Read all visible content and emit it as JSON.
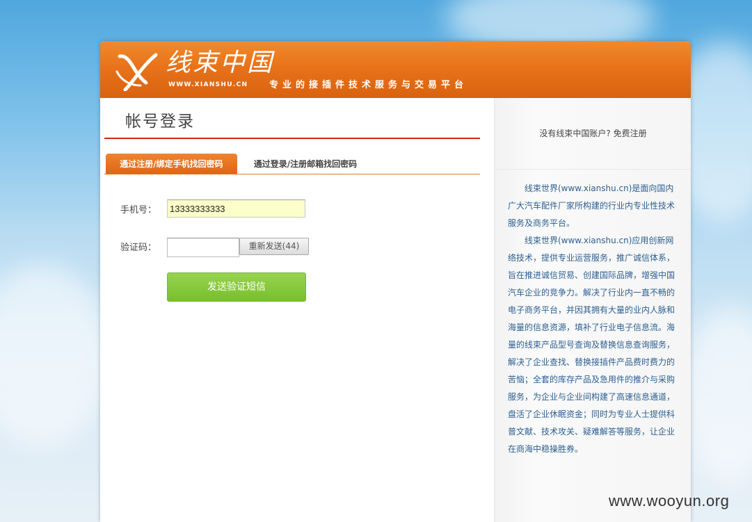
{
  "header": {
    "logo_text": "线束中国",
    "logo_url": "WWW.XIANSHU.CN",
    "slogan": "专业的接插件技术服务与交易平台"
  },
  "main": {
    "title": "帐号登录",
    "tabs": [
      {
        "label": "通过注册/绑定手机找回密码",
        "active": true
      },
      {
        "label": "通过登录/注册邮箱找回密码",
        "active": false
      }
    ],
    "form": {
      "phone_label": "手机号：",
      "phone_value": "13333333333",
      "code_label": "验证码：",
      "code_value": "",
      "resend_label": "重新发送(44)",
      "send_label": "发送验证短信"
    }
  },
  "sidebar": {
    "register_prompt": "没有线束中国账户? 免费注册",
    "about_paragraphs": [
      "线束世界(www.xianshu.cn)是面向国内广大汽车配件厂家所构建的行业内专业性技术服务及商务平台。",
      "线束世界(www.xianshu.cn)应用创新网络技术，提供专业运营服务，推广诚信体系，旨在推进诚信贸易、创建国际品牌，增强中国汽车企业的竞争力。解决了行业内一直不畅的电子商务平台，并因其拥有大量的业内人脉和海量的信息资源，填补了行业电子信息流。海量的线束产品型号查询及替换信息查询服务，解决了企业查找、替换接插件产品费时费力的苦恼；全套的库存产品及急用件的推介与采购服务，为企业与企业间构建了高速信息通道，盘活了企业休眠资金；同时为专业人士提供科普文献、技术攻关、疑难解答等服务，让企业在商海中稳操胜券。"
    ]
  },
  "watermark": "www.wooyun.org",
  "colors": {
    "header_orange": "#e8731a",
    "title_rule_red": "#c8281c",
    "send_button_green": "#84c83a",
    "about_text_blue": "#2c5f92",
    "phone_input_bg": "#fbffc9"
  }
}
